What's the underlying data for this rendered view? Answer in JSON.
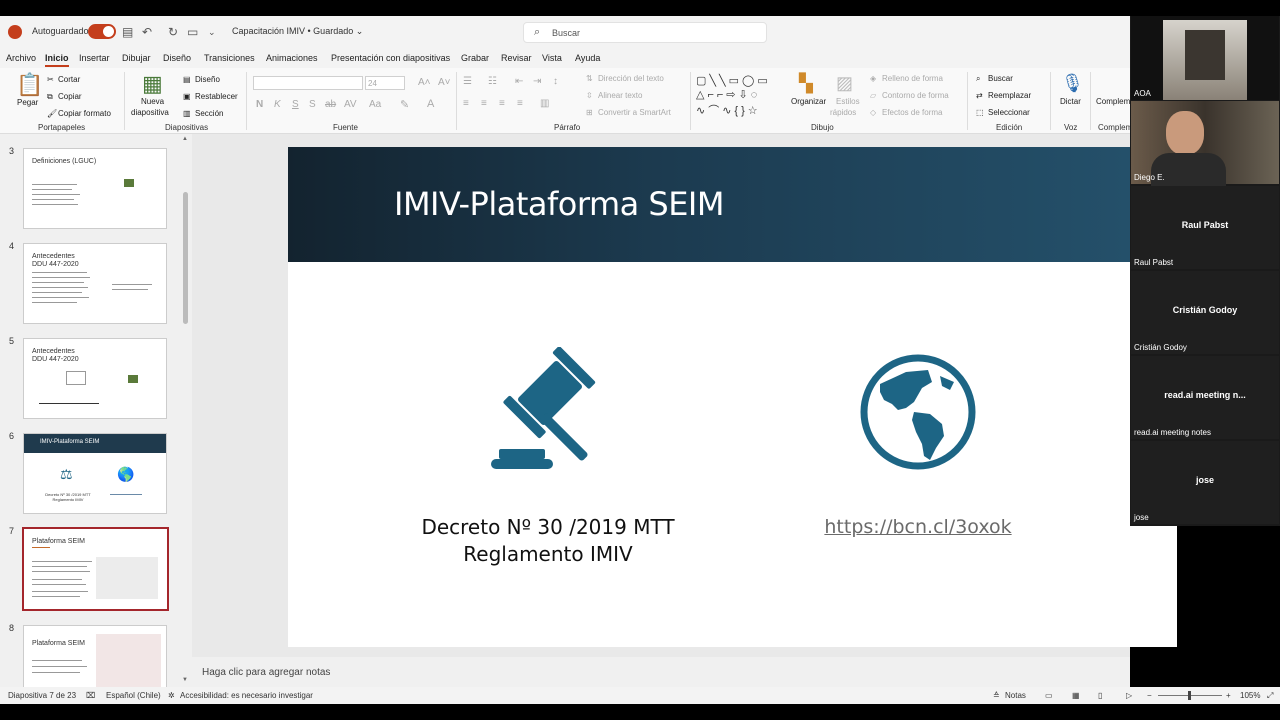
{
  "titlebar": {
    "autosave_label": "Autoguardado",
    "doc_title": "Capacitación IMIV • Guardado ⌄",
    "search_placeholder": "Buscar"
  },
  "menu": [
    "Archivo",
    "Inicio",
    "Insertar",
    "Dibujar",
    "Diseño",
    "Transiciones",
    "Animaciones",
    "Presentación con diapositivas",
    "Grabar",
    "Revisar",
    "Vista",
    "Ayuda"
  ],
  "ribbon": {
    "paste": "Pegar",
    "cut": "Cortar",
    "copy": "Copiar",
    "format_painter": "Copiar formato",
    "group_clipboard": "Portapapeles",
    "new_slide_1": "Nueva",
    "new_slide_2": "diapositiva",
    "layout": "Diseño",
    "reset": "Restablecer",
    "section": "Sección",
    "group_slides": "Diapositivas",
    "font_size": "24",
    "font_buttons": [
      "N",
      "K",
      "S",
      "S",
      "ab",
      "AV",
      "Aa"
    ],
    "group_font": "Fuente",
    "text_direction": "Dirección del texto",
    "align_text": "Alinear texto",
    "smartart": "Convertir a SmartArt",
    "group_paragraph": "Párrafo",
    "arrange": "Organizar",
    "quick_styles_1": "Estilos",
    "quick_styles_2": "rápidos",
    "shape_fill": "Relleno de forma",
    "shape_outline": "Contorno de forma",
    "shape_effects": "Efectos de forma",
    "group_drawing": "Dibujo",
    "find": "Buscar",
    "replace": "Reemplazar",
    "select": "Seleccionar",
    "group_editing": "Edición",
    "dictate": "Dictar",
    "group_voice": "Voz",
    "addins": "Complem",
    "group_addins": "Complem"
  },
  "thumbnails": [
    {
      "num": "3",
      "title": "Definiciones (LGUC)"
    },
    {
      "num": "4",
      "title": "Antecedentes\nDDU 447-2020"
    },
    {
      "num": "5",
      "title": "Antecedentes\nDDU 447-2020"
    },
    {
      "num": "6",
      "title": "IMIV-Plataforma SEIM",
      "caption": "Decreto Nº 30 /2019 MTT\nReglamento IMIV"
    },
    {
      "num": "7",
      "title": "Plataforma SEIM"
    },
    {
      "num": "8",
      "title": "Plataforma SEIM"
    }
  ],
  "slide": {
    "title": "IMIV-Plataforma SEIM",
    "caption_line1": "Decreto Nº 30 /2019 MTT",
    "caption_line2": "Reglamento IMIV",
    "link": "https://bcn.cl/3oxok",
    "accent_color": "#1d6585",
    "header_color": "#1c3b50"
  },
  "notes_placeholder": "Haga clic para agregar notas",
  "status": {
    "slide_counter": "Diapositiva 7 de 23",
    "language": "Español (Chile)",
    "accessibility": "Accesibilidad: es necesario investigar",
    "notes": "Notas",
    "zoom": "105%"
  },
  "participants": [
    {
      "name": "AOA"
    },
    {
      "name": "Diego E."
    },
    {
      "name": "Raul Pabst",
      "label": "Raul Pabst"
    },
    {
      "name": "Cristián Godoy",
      "label": "Cristián Godoy"
    },
    {
      "name": "read.ai meeting n...",
      "label": "read.ai meeting notes"
    },
    {
      "name": "jose",
      "label": "jose"
    }
  ]
}
